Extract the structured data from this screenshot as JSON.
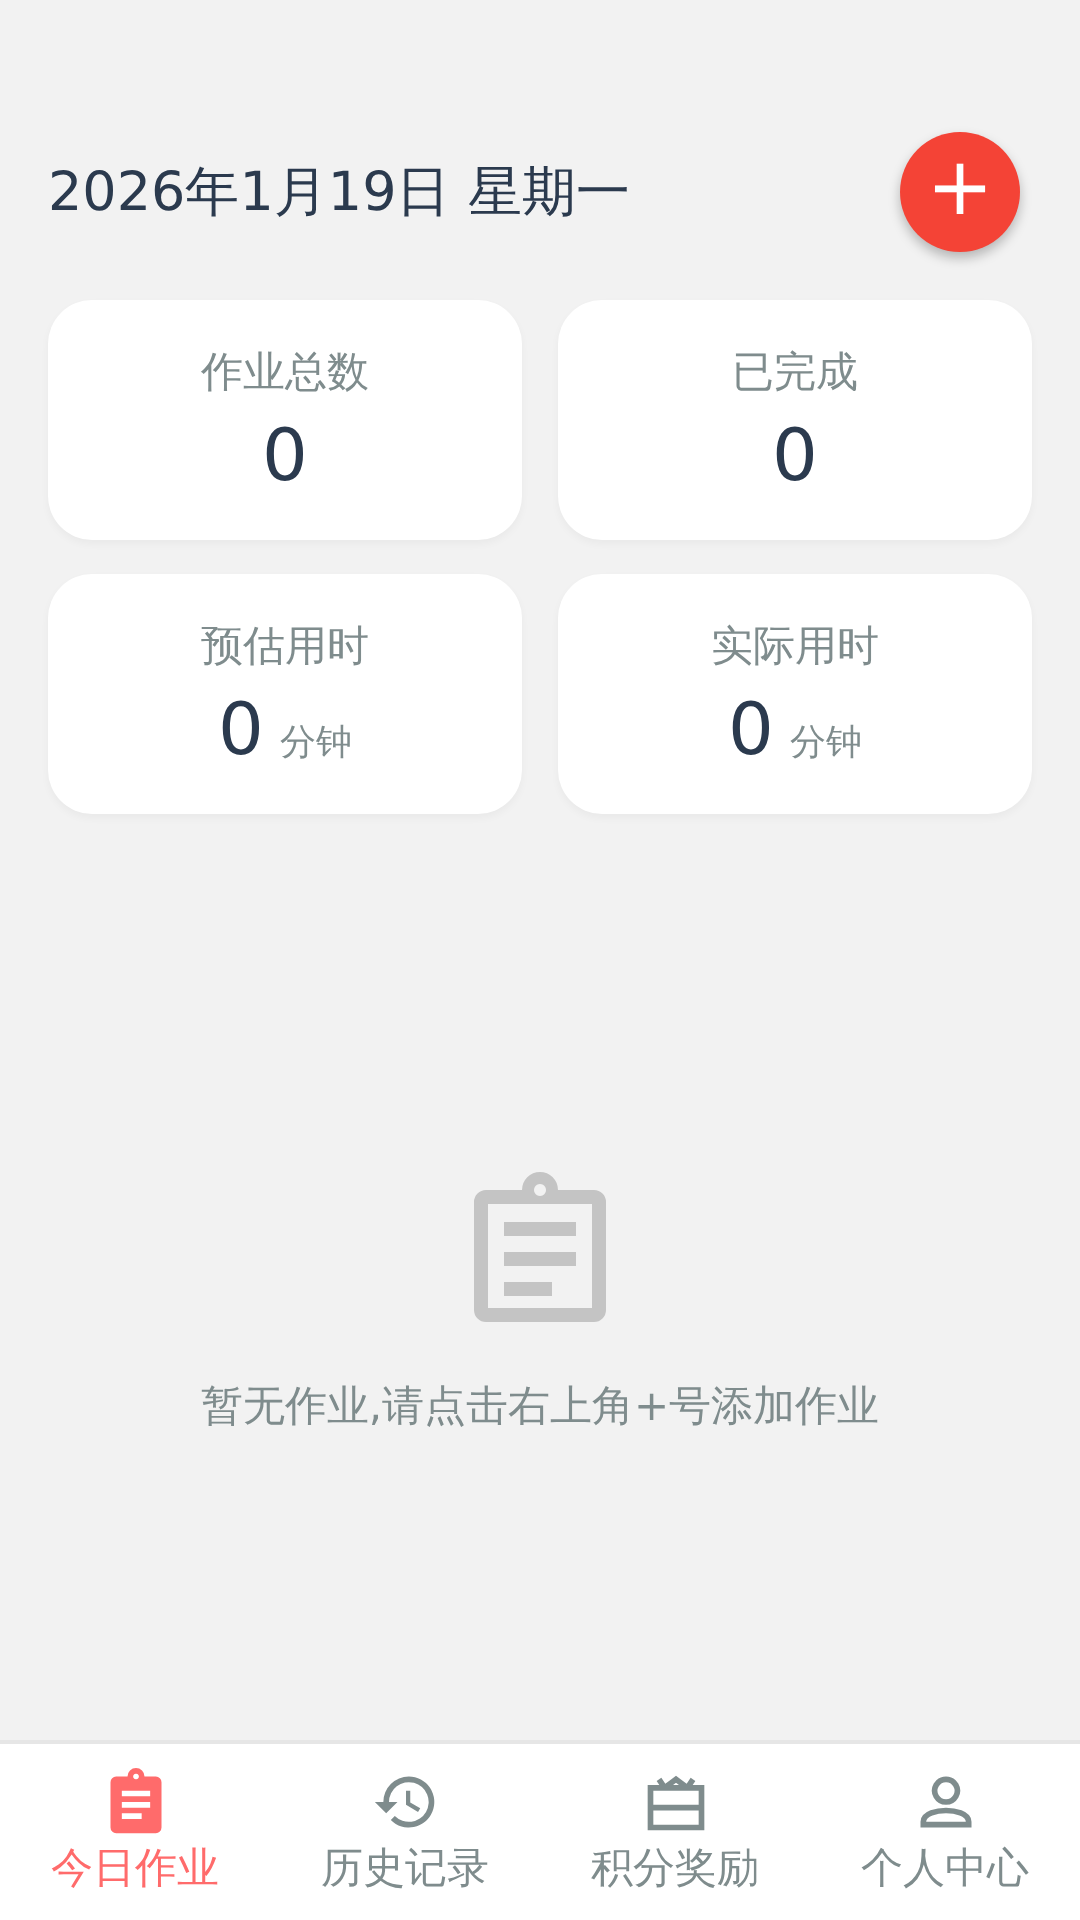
{
  "header": {
    "date": "2026年1月19日 星期一",
    "add_button": "+"
  },
  "stats": [
    {
      "label": "作业总数",
      "value": "0"
    },
    {
      "label": "已完成",
      "value": "0"
    },
    {
      "label": "预估用时",
      "value": "0",
      "unit": "分钟"
    },
    {
      "label": "实际用时",
      "value": "0",
      "unit": "分钟"
    }
  ],
  "empty_state": {
    "message": "暂无作业,请点击右上角+号添加作业"
  },
  "tabs": [
    {
      "kind": "homework",
      "label": "今日作业",
      "selected": true
    },
    {
      "kind": "history",
      "label": "历史记录",
      "selected": false
    },
    {
      "kind": "rewards",
      "label": "积分奖励",
      "selected": false
    },
    {
      "kind": "profile",
      "label": "个人中心",
      "selected": false
    }
  ]
}
